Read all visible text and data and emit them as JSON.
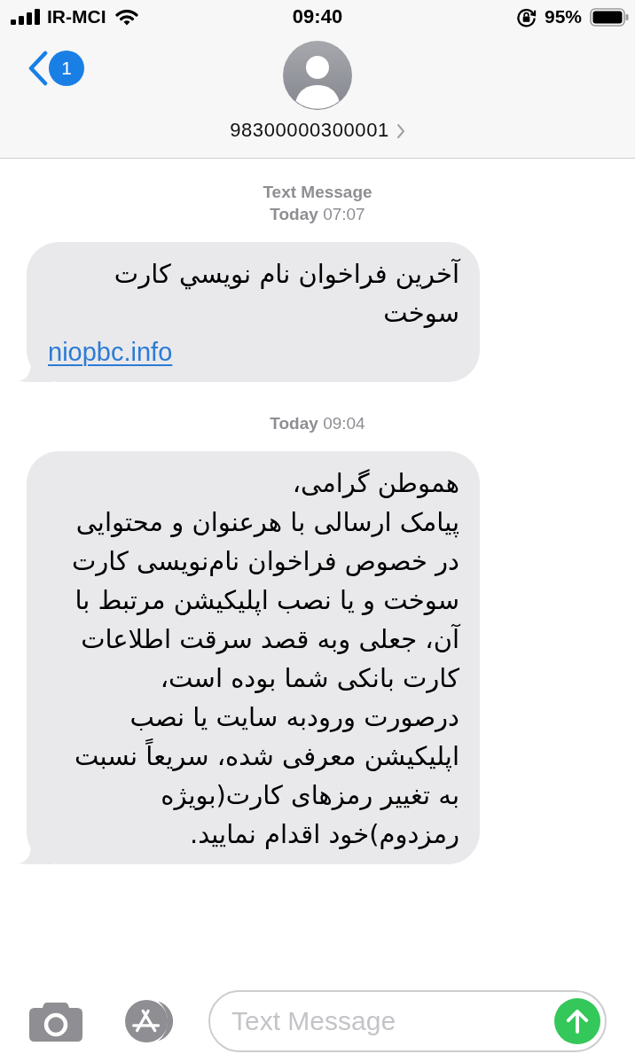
{
  "status_bar": {
    "carrier": "IR-MCI",
    "time": "09:40",
    "battery": "95%"
  },
  "header": {
    "back_badge": "1",
    "contact": "98300000300001"
  },
  "messages": [
    {
      "header": "Text Message",
      "timestamp": "**Today** 07:07",
      "text": "آخرين فراخوان نام نويسي کارت\nسوخت",
      "link": "niopbc.info"
    },
    {
      "timestamp": "**Today** 09:04",
      "text": "هموطن گرامی،\nپیامک ارسالی با هرعنوان و محتوایی\nدر خصوص فراخوان نام‌نویسی کارت\nسوخت و یا نصب اپلیکیشن مرتبط با\nآن، جعلی وبه قصد سرقت اطلاعات\nکارت بانکی شما بوده است،\nدرصورت ورودبه سایت یا نصب\nاپلیکیشن معرفی شده، سریعاً نسبت\nبه تغییر رمزهای کارت(بویژه\nرمزدوم)خود اقدام نمایید."
    }
  ],
  "composer": {
    "placeholder": "Text Message"
  }
}
